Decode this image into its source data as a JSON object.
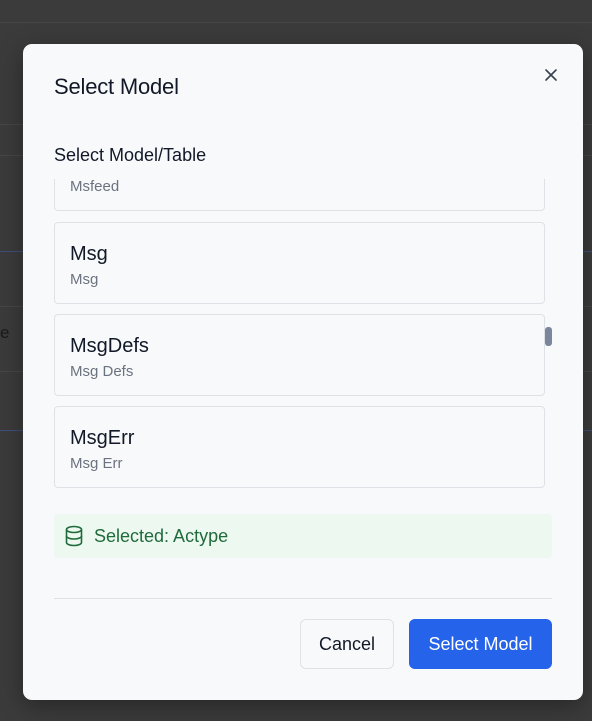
{
  "background": {
    "partial_text": "e"
  },
  "modal": {
    "title": "Select Model",
    "close_icon": "close-icon",
    "section_label": "Select Model/Table",
    "models": [
      {
        "name": "",
        "description": "Msfeed"
      },
      {
        "name": "Msg",
        "description": "Msg"
      },
      {
        "name": "MsgDefs",
        "description": "Msg Defs"
      },
      {
        "name": "MsgErr",
        "description": "Msg Err"
      }
    ],
    "selected": {
      "icon": "database-icon",
      "text": "Selected: Actype"
    },
    "buttons": {
      "cancel": "Cancel",
      "select": "Select Model"
    }
  },
  "colors": {
    "primary": "#2563eb",
    "success_bg": "#edf8f1",
    "success_text": "#1f6b3a"
  }
}
